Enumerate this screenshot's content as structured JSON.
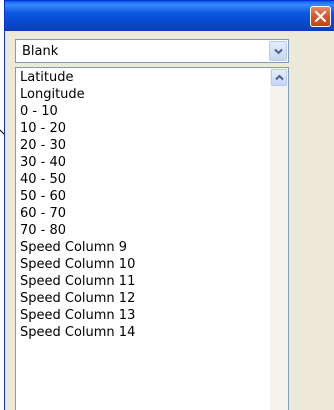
{
  "window": {
    "close_icon": "close-x-icon"
  },
  "combo": {
    "selected_value": "Blank",
    "arrow_icon": "chevron-down-icon"
  },
  "listbox": {
    "items": [
      "Latitude",
      "Longitude",
      "0 - 10",
      "10 - 20",
      "20 - 30",
      "30 - 40",
      "40 - 50",
      "50 - 60",
      "60 - 70",
      "70 - 80",
      "Speed Column 9",
      "Speed Column 10",
      "Speed Column 11",
      "Speed Column 12",
      "Speed Column 13",
      "Speed Column 14"
    ],
    "scroll_up_icon": "chevron-up-icon"
  },
  "colors": {
    "titlebar": "#0a58e0",
    "close_button": "#d9582e",
    "window_face": "#ece9d8",
    "field_border": "#7f9db9"
  }
}
